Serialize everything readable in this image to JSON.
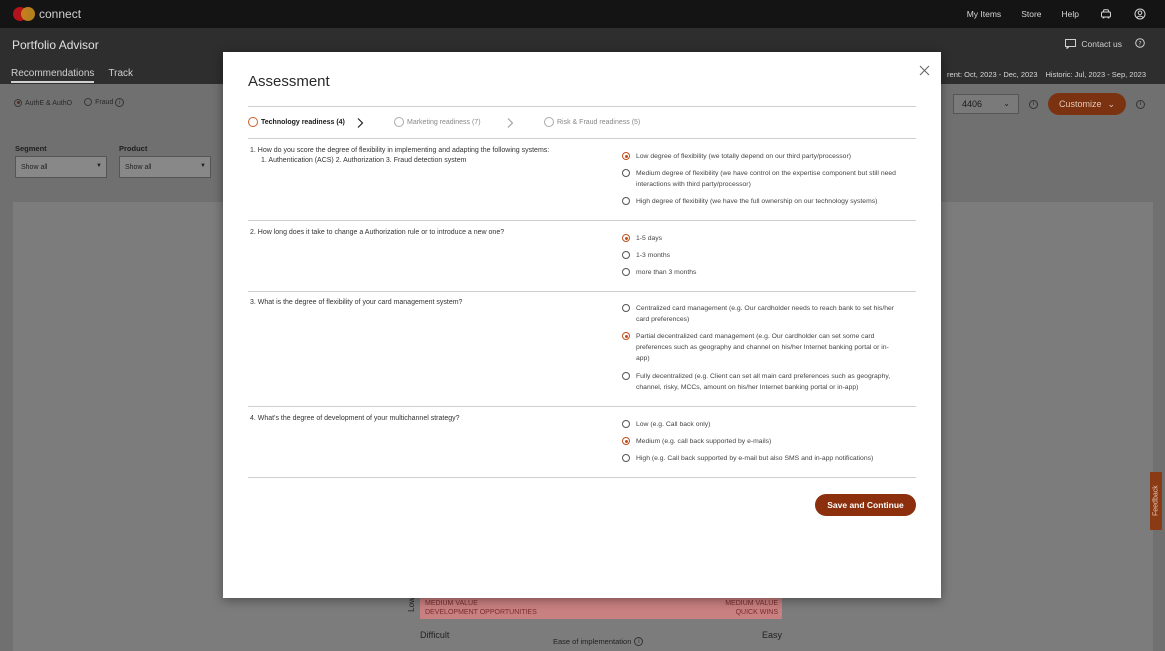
{
  "topbar": {
    "brand": "connect",
    "nav": [
      "My Items",
      "Store",
      "Help"
    ],
    "icons": [
      "car-icon",
      "user-icon"
    ]
  },
  "app": {
    "title": "Portfolio Advisor",
    "contact": "Contact us",
    "tabs": [
      "Recommendations",
      "Track"
    ],
    "period_current": "rent: Oct, 2023 - Dec, 2023",
    "period_historic": "Historic: Jul, 2023 - Sep, 2023"
  },
  "filters": {
    "toggles": [
      {
        "label": "AuthE & AuthO",
        "selected": true
      },
      {
        "label": "Fraud",
        "selected": false
      }
    ],
    "segment_label": "Segment",
    "segment_value": "Show all",
    "product_label": "Product",
    "product_value": "Show all",
    "bin_value": "4406",
    "customize_label": "Customize"
  },
  "matrix": {
    "left_line1": "MEDIUM VALUE",
    "left_line2": "DEVELOPMENT OPPORTUNITIES",
    "right_line1": "MEDIUM VALUE",
    "right_line2": "QUICK WINS",
    "y_low": "Low",
    "x_difficult": "Difficult",
    "x_easy": "Easy",
    "x_title": "Ease of implementation"
  },
  "feedback": "Feedback",
  "modal": {
    "title": "Assessment",
    "steps": [
      {
        "label": "Technology readiness (4)",
        "active": true
      },
      {
        "label": "Marketing readiness (7)",
        "active": false
      },
      {
        "label": "Risk & Fraud readiness (5)",
        "active": false
      }
    ],
    "questions": [
      {
        "text": "1.  How do you score the degree of flexibility in implementing and adapting the following systems:",
        "text2": "1. Authentication (ACS) 2. Authorization 3. Fraud detection system",
        "options": [
          {
            "label": "Low degree of flexibility (we totally depend on our third party/processor)",
            "selected": true
          },
          {
            "label": "Medium degree of flexibility (we have control on the expertise component but still need interactions with third party/processor)",
            "selected": false
          },
          {
            "label": "High degree of flexibility (we have the full ownership on our technology systems)",
            "selected": false
          }
        ]
      },
      {
        "text": "2.  How long does it take to change a Authorization rule or to introduce a new one?",
        "text2": "",
        "options": [
          {
            "label": "1-5 days",
            "selected": true
          },
          {
            "label": "1-3 months",
            "selected": false
          },
          {
            "label": "more than 3 months",
            "selected": false
          }
        ]
      },
      {
        "text": "3.  What is the degree of flexibility of your card management system?",
        "text2": "",
        "options": [
          {
            "label": "Centralized card management (e.g. Our cardholder needs to reach bank to set his/her card preferences)",
            "selected": false
          },
          {
            "label": "Partial decentralized card management (e.g. Our cardholder can set some card preferences such as geography and channel on his/her Internet banking portal or in-app)",
            "selected": true
          },
          {
            "label": "Fully decentralized (e.g. Client can set all main card preferences such as geography, channel, risky, MCCs, amount on his/her Internet banking portal or in-app)",
            "selected": false
          }
        ]
      },
      {
        "text": "4.  What's the degree of development of your multichannel strategy?",
        "text2": "",
        "options": [
          {
            "label": "Low (e.g. Call back only)",
            "selected": false
          },
          {
            "label": "Medium (e.g. call back supported by e-mails)",
            "selected": true
          },
          {
            "label": "High (e.g. Call back supported by e-mail but also SMS and in-app notifications)",
            "selected": false
          }
        ]
      }
    ],
    "save_label": "Save and Continue"
  },
  "colors": {
    "accent": "#8b2f0c",
    "radio_selected": "#c0501f",
    "topbar": "#141414"
  }
}
